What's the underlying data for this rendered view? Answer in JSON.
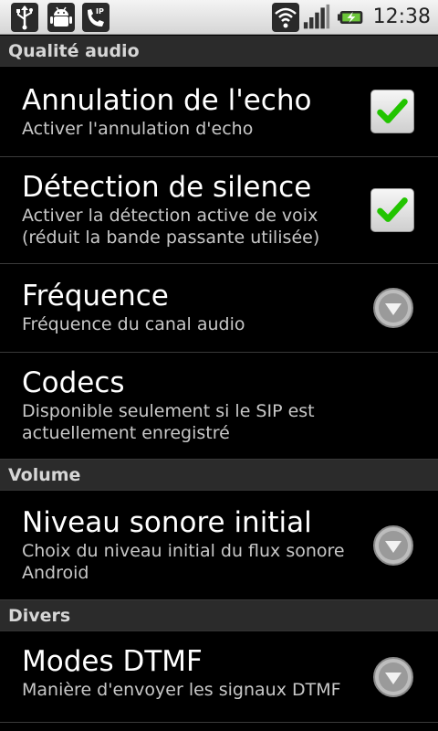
{
  "status_bar": {
    "time": "12:38",
    "left_icons": [
      "usb-icon",
      "android-debug-icon",
      "sip-phone-icon"
    ],
    "right_icons": [
      "wifi-icon",
      "signal-icon",
      "battery-charging-icon"
    ]
  },
  "sections": [
    {
      "header": "Qualité audio",
      "items": [
        {
          "title": "Annulation de l'echo",
          "summary": "Activer l'annulation d'echo",
          "widget": "checkbox",
          "checked": true
        },
        {
          "title": "Détection de silence",
          "summary": "Activer la détection active de voix (réduit la bande passante utilisée)",
          "widget": "checkbox",
          "checked": true
        },
        {
          "title": "Fréquence",
          "summary": "Fréquence du canal audio",
          "widget": "dropdown"
        },
        {
          "title": "Codecs",
          "summary": "Disponible seulement si le SIP est actuellement enregistré",
          "widget": "none"
        }
      ]
    },
    {
      "header": "Volume",
      "items": [
        {
          "title": "Niveau sonore initial",
          "summary": "Choix du niveau initial du flux sonore Android",
          "widget": "dropdown"
        }
      ]
    },
    {
      "header": "Divers",
      "items": [
        {
          "title": "Modes DTMF",
          "summary": "Manière d'envoyer les signaux DTMF",
          "widget": "dropdown"
        }
      ]
    }
  ],
  "colors": {
    "background": "#000000",
    "category_bg": "#2b2b2b",
    "check_green": "#22c400"
  }
}
